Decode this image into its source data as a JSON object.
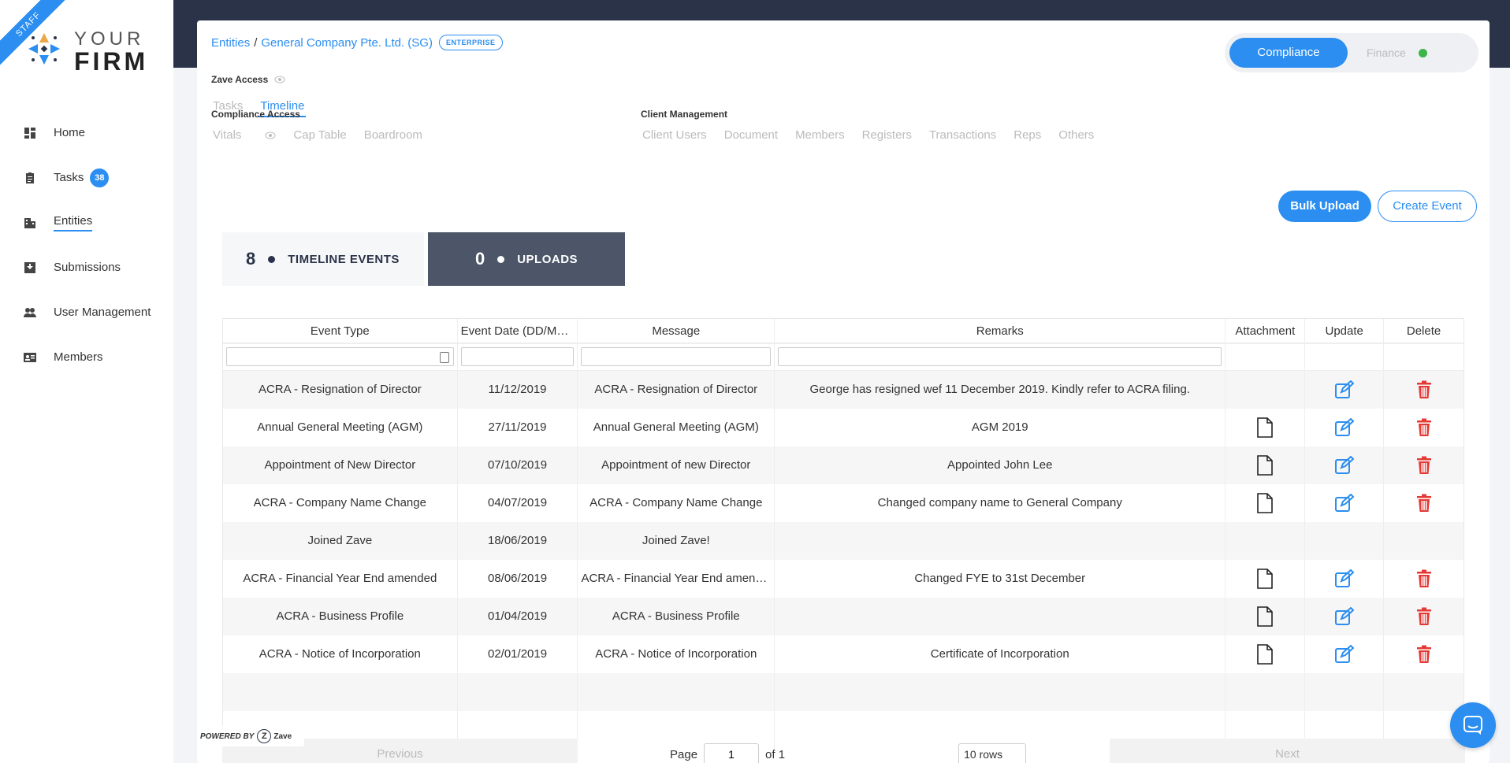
{
  "brand": {
    "ribbon": "STAFF",
    "logo_line1": "YOUR",
    "logo_line2": "FIRM"
  },
  "sidebar": {
    "items": [
      {
        "label": "Home",
        "icon": "dashboard-icon"
      },
      {
        "label": "Tasks",
        "icon": "clipboard-icon",
        "badge": "38"
      },
      {
        "label": "Entities",
        "icon": "building-icon",
        "active": true
      },
      {
        "label": "Submissions",
        "icon": "inbox-icon"
      },
      {
        "label": "User Management",
        "icon": "people-icon"
      },
      {
        "label": "Members",
        "icon": "id-card-icon"
      }
    ]
  },
  "header": {
    "breadcrumb_root": "Entities",
    "breadcrumb_sep": "/",
    "entity_name": "General Company Pte. Ltd. (SG)",
    "entity_badge": "ENTERPRISE",
    "toggle_active": "Compliance",
    "toggle_inactive": "Finance"
  },
  "zave_access": "Zave Access",
  "tabs": [
    "Tasks",
    "Timeline"
  ],
  "compliance_access": {
    "label": "Compliance Access",
    "links": [
      "Vitals",
      "Cap Table",
      "Boardroom"
    ]
  },
  "client_management": {
    "label": "Client Management",
    "links": [
      "Client Users",
      "Document",
      "Members",
      "Registers",
      "Transactions",
      "Reps",
      "Others"
    ]
  },
  "actions": {
    "bulk_upload": "Bulk Upload",
    "create_event": "Create Event"
  },
  "stats": {
    "timeline_count": "8",
    "timeline_label": "TIMELINE EVENTS",
    "uploads_count": "0",
    "uploads_label": "UPLOADS"
  },
  "table": {
    "columns": [
      "Event Type",
      "Event Date (DD/MM/YYYY)",
      "Message",
      "Remarks",
      "Attachment",
      "Update",
      "Delete"
    ],
    "rows": [
      {
        "type": "ACRA - Resignation of Director",
        "date": "11/12/2019",
        "message": "ACRA - Resignation of Director",
        "remarks": "George has resigned wef 11 December 2019. Kindly refer to ACRA filing.",
        "attachment": false,
        "editable": true
      },
      {
        "type": "Annual General Meeting (AGM)",
        "date": "27/11/2019",
        "message": "Annual General Meeting (AGM)",
        "remarks": "AGM 2019",
        "attachment": true,
        "editable": true
      },
      {
        "type": "Appointment of New Director",
        "date": "07/10/2019",
        "message": "Appointment of new Director",
        "remarks": "Appointed John Lee",
        "attachment": true,
        "editable": true
      },
      {
        "type": "ACRA - Company Name Change",
        "date": "04/07/2019",
        "message": "ACRA - Company Name Change",
        "remarks": "Changed company name to General Company",
        "attachment": true,
        "editable": true
      },
      {
        "type": "Joined Zave",
        "date": "18/06/2019",
        "message": "Joined Zave!",
        "remarks": "",
        "attachment": false,
        "editable": false
      },
      {
        "type": "ACRA - Financial Year End amended",
        "date": "08/06/2019",
        "message": "ACRA - Financial Year End amended",
        "remarks": "Changed FYE to 31st December",
        "attachment": true,
        "editable": true
      },
      {
        "type": "ACRA - Business Profile",
        "date": "01/04/2019",
        "message": "ACRA - Business Profile",
        "remarks": "",
        "attachment": true,
        "editable": true
      },
      {
        "type": "ACRA - Notice of Incorporation",
        "date": "02/01/2019",
        "message": "ACRA - Notice of Incorporation",
        "remarks": "Certificate of Incorporation",
        "attachment": true,
        "editable": true
      }
    ]
  },
  "pagination": {
    "previous": "Previous",
    "page_label": "Page",
    "page_value": "1",
    "of_label": "of 1",
    "rows_select": "10 rows",
    "next": "Next"
  },
  "powered_by": {
    "label": "POWERED BY",
    "brand": "Zave"
  },
  "colors": {
    "accent": "#2b8ef0",
    "danger": "#e53935",
    "dark": "#2a3348",
    "status_green": "#3cb54a"
  }
}
